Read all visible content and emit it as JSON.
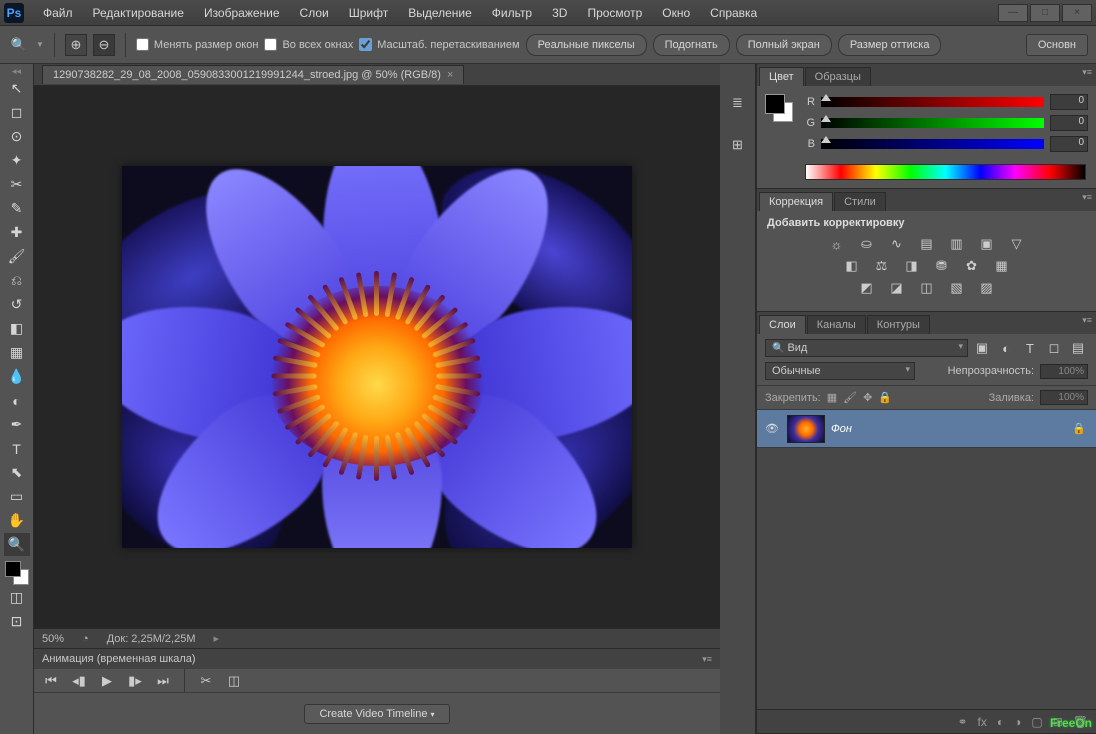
{
  "app_logo": "Ps",
  "menu": {
    "file": "Файл",
    "edit": "Редактирование",
    "image": "Изображение",
    "layer": "Слои",
    "type": "Шрифт",
    "select": "Выделение",
    "filter": "Фильтр",
    "threeD": "3D",
    "view": "Просмотр",
    "window": "Окно",
    "help": "Справка"
  },
  "options_bar": {
    "resize_windows": "Менять размер окон",
    "all_windows": "Во всех окнах",
    "scrubby_zoom": "Масштаб. перетаскиванием",
    "actual_pixels": "Реальные пикселы",
    "fit_screen": "Подогнать",
    "full_screen": "Полный экран",
    "print_size": "Размер оттиска",
    "basics": "Основн"
  },
  "document": {
    "tab_title": "1290738282_29_08_2008_0590833001219991244_stroed.jpg @ 50% (RGB/8)",
    "zoom": "50%",
    "doc_size": "Док: 2,25M/2,25M"
  },
  "timeline": {
    "title": "Анимация (временная шкала)",
    "create_btn": "Create Video Timeline"
  },
  "panels": {
    "color": {
      "tab_color": "Цвет",
      "tab_swatches": "Образцы",
      "r": "R",
      "g": "G",
      "b": "B",
      "r_val": "0",
      "g_val": "0",
      "b_val": "0"
    },
    "adjustments": {
      "tab_corr": "Коррекция",
      "tab_styles": "Стили",
      "add_label": "Добавить корректировку"
    },
    "layers": {
      "tab_layers": "Слои",
      "tab_channels": "Каналы",
      "tab_paths": "Контуры",
      "kind": "Вид",
      "blend": "Обычные",
      "opacity_label": "Непрозрачность:",
      "opacity_val": "100%",
      "lock_label": "Закрепить:",
      "fill_label": "Заливка:",
      "fill_val": "100%",
      "layer1_name": "Фон"
    }
  },
  "watermark": "FreeOn"
}
